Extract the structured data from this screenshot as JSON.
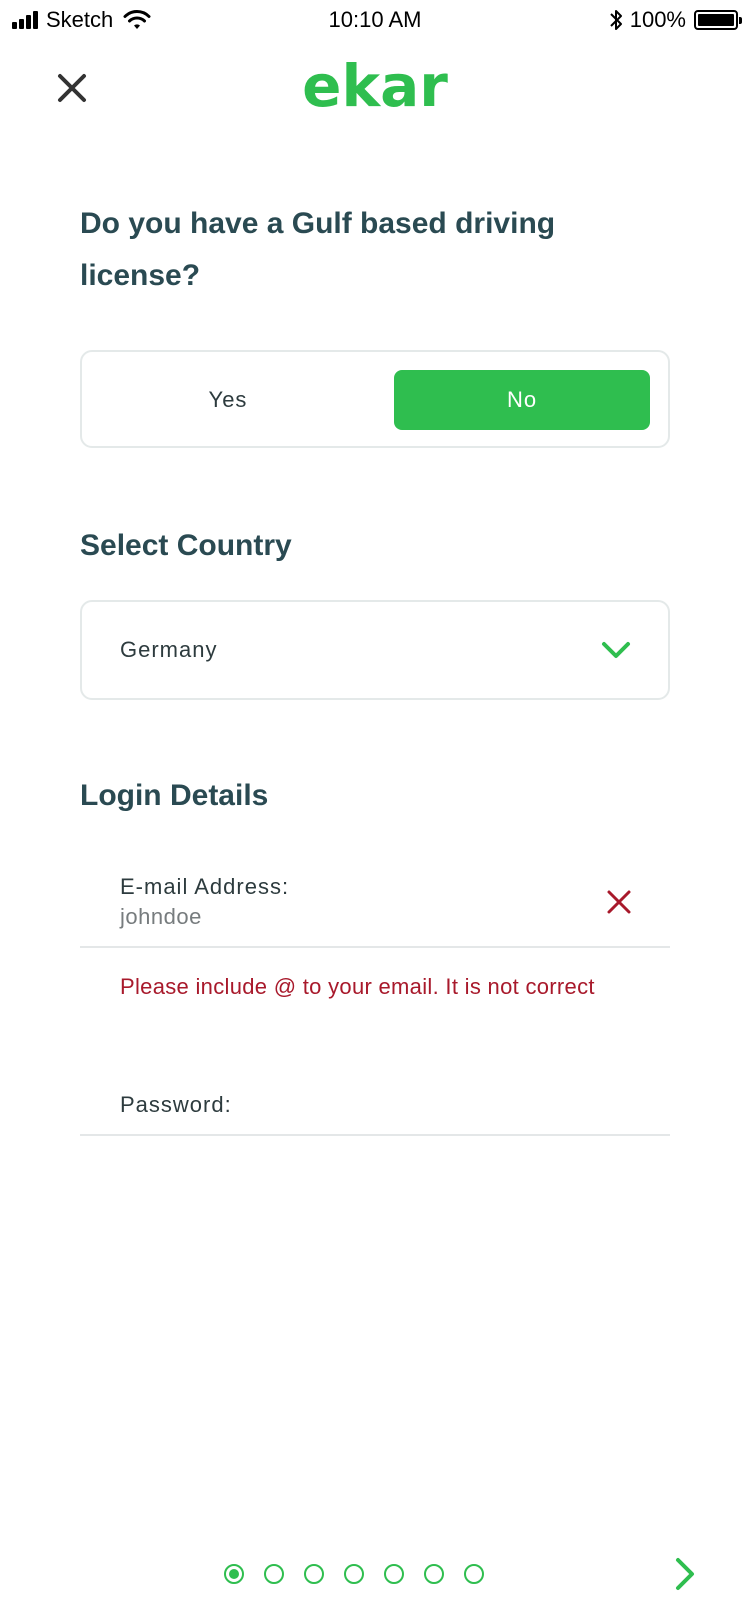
{
  "status_bar": {
    "carrier": "Sketch",
    "time": "10:10 AM",
    "battery": "100%"
  },
  "header": {
    "logo": "ekar",
    "close_icon": "close-icon"
  },
  "license_question": {
    "title": "Do you have a Gulf based driving license?",
    "options": [
      "Yes",
      "No"
    ],
    "selected": "No"
  },
  "country": {
    "title": "Select Country",
    "value": "Germany",
    "icon": "chevron-down-icon"
  },
  "login": {
    "title": "Login Details",
    "email_label": "E-mail Address:",
    "email_value": "johndoe",
    "email_error": "Please include @ to your email. It is not correct",
    "password_label": "Password:"
  },
  "pager": {
    "total_steps": 7,
    "current_step": 1
  },
  "colors": {
    "brand_green": "#2fbe4f",
    "heading": "#2a4a52",
    "error_red": "#a8192b",
    "border": "#e4e9e9"
  }
}
